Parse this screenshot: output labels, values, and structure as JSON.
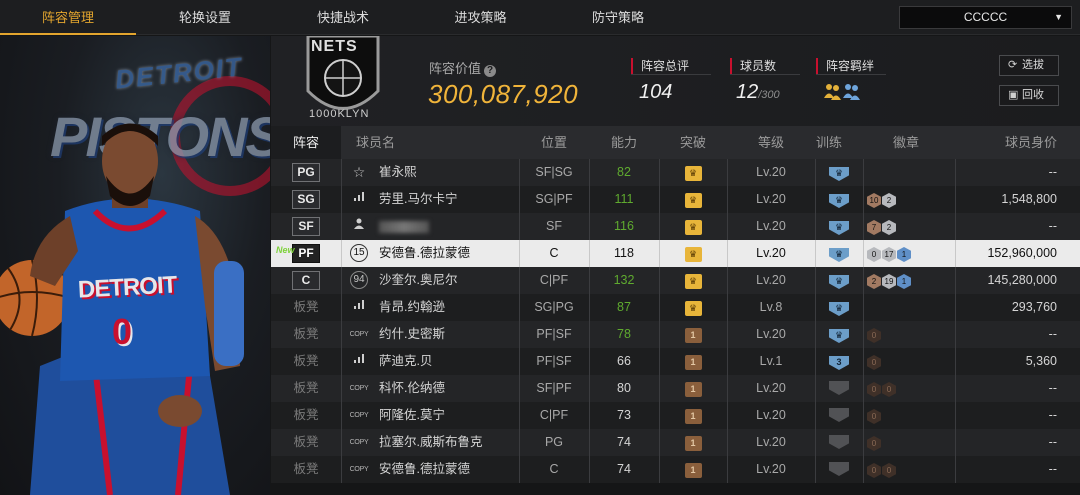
{
  "tabs": [
    {
      "label": "阵容管理",
      "active": true
    },
    {
      "label": "轮换设置",
      "active": false
    },
    {
      "label": "快捷战术",
      "active": false
    },
    {
      "label": "进攻策略",
      "active": false
    },
    {
      "label": "防守策略",
      "active": false
    }
  ],
  "team_select": {
    "value": "CCCCC"
  },
  "hero": {
    "logo_top": "DETROIT",
    "logo_mid": "PISTONS",
    "jersey_team": "DETROIT",
    "jersey_number": "0"
  },
  "team_logo": {
    "name": "NETS",
    "sub": "1000KLYN"
  },
  "header": {
    "value_label": "阵容价值",
    "value": "300,087,920",
    "rating_label": "阵容总评",
    "rating": "104",
    "count_label": "球员数",
    "count": "12",
    "count_max": "/300",
    "bond_label": "阵容羁绊",
    "btn_select": "选拔",
    "btn_recycle": "回收"
  },
  "columns": {
    "lineup": "阵容",
    "name": "球员名",
    "position": "位置",
    "ability": "能力",
    "breakthrough": "突破",
    "level": "等级",
    "training": "训练",
    "badges": "徽章",
    "value": "球员身价"
  },
  "colors": {
    "accent": "#e3a52e",
    "value_gold": "#f0b43a",
    "green": "#5faa2f",
    "team_red": "#c8102e"
  },
  "rows": [
    {
      "lineup": "PG",
      "icon": "star-icon",
      "icon_text": "☆",
      "name": "崔永熙",
      "position": "SF|SG",
      "ability": "82",
      "green": true,
      "break": "gold",
      "level": "Lv.20",
      "train": "blue",
      "train_text": "",
      "badges": [],
      "value": "--"
    },
    {
      "lineup": "SG",
      "icon": "signal-icon",
      "icon_text": "",
      "name": "劳里.马尔卡宁",
      "position": "SG|PF",
      "ability": "111",
      "green": true,
      "break": "gold",
      "level": "Lv.20",
      "train": "blue",
      "train_text": "",
      "badges": [
        {
          "t": "bronze",
          "n": "10"
        },
        {
          "t": "silver",
          "n": "2"
        }
      ],
      "value": "1,548,800"
    },
    {
      "lineup": "SF",
      "icon": "person-icon",
      "icon_text": "",
      "name": "",
      "blurred": true,
      "position": "SF",
      "ability": "116",
      "green": true,
      "break": "gold",
      "level": "Lv.20",
      "train": "blue",
      "train_text": "",
      "badges": [
        {
          "t": "bronze",
          "n": "7"
        },
        {
          "t": "silver",
          "n": "2"
        }
      ],
      "value": "--"
    },
    {
      "lineup": "PF",
      "new": "New",
      "selected": true,
      "icon": "number-icon",
      "icon_text": "15",
      "name": "安德鲁.德拉蒙德",
      "position": "C",
      "ability": "118",
      "green": false,
      "break": "gold",
      "level": "Lv.20",
      "train": "blue",
      "train_text": "",
      "badges": [
        {
          "t": "silver",
          "n": "0"
        },
        {
          "t": "silver",
          "n": "17"
        },
        {
          "t": "blue",
          "n": "1"
        }
      ],
      "value": "152,960,000"
    },
    {
      "lineup": "C",
      "icon": "number-icon",
      "icon_text": "94",
      "name": "沙奎尔.奥尼尔",
      "position": "C|PF",
      "ability": "132",
      "green": true,
      "break": "gold",
      "level": "Lv.20",
      "train": "blue",
      "train_text": "",
      "badges": [
        {
          "t": "bronze",
          "n": "2"
        },
        {
          "t": "silver",
          "n": "19"
        },
        {
          "t": "blue",
          "n": "1"
        }
      ],
      "value": "145,280,000"
    },
    {
      "lineup": "板凳",
      "bench": true,
      "icon": "signal-icon",
      "icon_text": "",
      "name": "肯昂.约翰逊",
      "position": "SG|PG",
      "ability": "87",
      "green": true,
      "break": "gold",
      "level": "Lv.8",
      "train": "blue",
      "train_text": "",
      "badges": [],
      "value": "293,760"
    },
    {
      "lineup": "板凳",
      "bench": true,
      "icon": "copy-icon",
      "icon_text": "COPY",
      "name": "约什.史密斯",
      "position": "PF|SF",
      "ability": "78",
      "green": true,
      "break": "brown",
      "level": "Lv.20",
      "train": "blue",
      "train_text": "",
      "badges": [
        {
          "t": "dark",
          "n": "0"
        }
      ],
      "value": "--"
    },
    {
      "lineup": "板凳",
      "bench": true,
      "icon": "signal-icon",
      "icon_text": "",
      "name": "萨迪克.贝",
      "position": "PF|SF",
      "ability": "66",
      "green": false,
      "break": "brown",
      "level": "Lv.1",
      "train": "blue",
      "train_text": "3",
      "badges": [
        {
          "t": "dark",
          "n": "0"
        }
      ],
      "value": "5,360"
    },
    {
      "lineup": "板凳",
      "bench": true,
      "icon": "copy-icon",
      "icon_text": "COPY",
      "name": "科怀.伦纳德",
      "position": "SF|PF",
      "ability": "80",
      "green": false,
      "break": "brown",
      "level": "Lv.20",
      "train": "gray",
      "train_text": "",
      "badges": [
        {
          "t": "dark",
          "n": "0"
        },
        {
          "t": "dark",
          "n": "0"
        }
      ],
      "value": "--"
    },
    {
      "lineup": "板凳",
      "bench": true,
      "icon": "copy-icon",
      "icon_text": "COPY",
      "name": "阿隆佐.莫宁",
      "position": "C|PF",
      "ability": "73",
      "green": false,
      "break": "brown",
      "level": "Lv.20",
      "train": "gray",
      "train_text": "",
      "badges": [
        {
          "t": "dark",
          "n": "0"
        }
      ],
      "value": "--"
    },
    {
      "lineup": "板凳",
      "bench": true,
      "icon": "copy-icon",
      "icon_text": "COPY",
      "name": "拉塞尔.威斯布鲁克",
      "position": "PG",
      "ability": "74",
      "green": false,
      "break": "brown",
      "level": "Lv.20",
      "train": "gray",
      "train_text": "",
      "badges": [
        {
          "t": "dark",
          "n": "0"
        }
      ],
      "value": "--"
    },
    {
      "lineup": "板凳",
      "bench": true,
      "icon": "copy-icon",
      "icon_text": "COPY",
      "name": "安德鲁.德拉蒙德",
      "position": "C",
      "ability": "74",
      "green": false,
      "break": "brown",
      "level": "Lv.20",
      "train": "gray",
      "train_text": "",
      "badges": [
        {
          "t": "dark",
          "n": "0"
        },
        {
          "t": "dark",
          "n": "0"
        }
      ],
      "value": "--"
    }
  ]
}
